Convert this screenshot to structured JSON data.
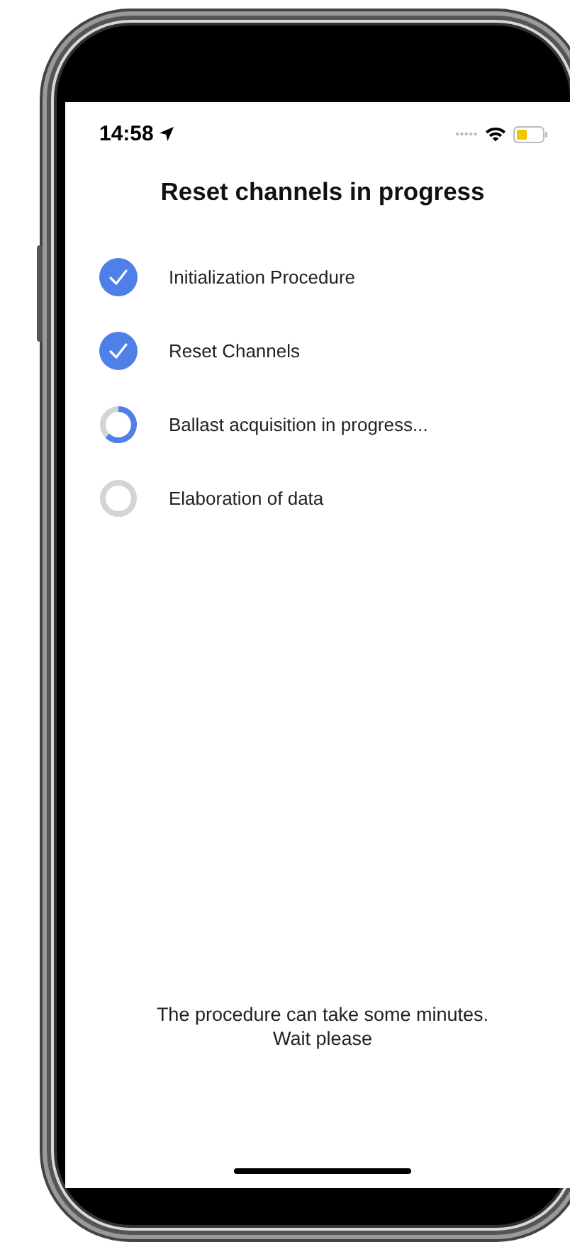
{
  "status_bar": {
    "time": "14:58"
  },
  "title": "Reset channels in progress",
  "steps": [
    {
      "label": "Initialization Procedure",
      "kind": "done"
    },
    {
      "label": "Reset Channels",
      "kind": "done"
    },
    {
      "label": "Ballast acquisition in progress...",
      "kind": "active"
    },
    {
      "label": "Elaboration of data",
      "kind": "pending"
    }
  ],
  "footer": [
    "The procedure can take some minutes.",
    "Wait please"
  ]
}
